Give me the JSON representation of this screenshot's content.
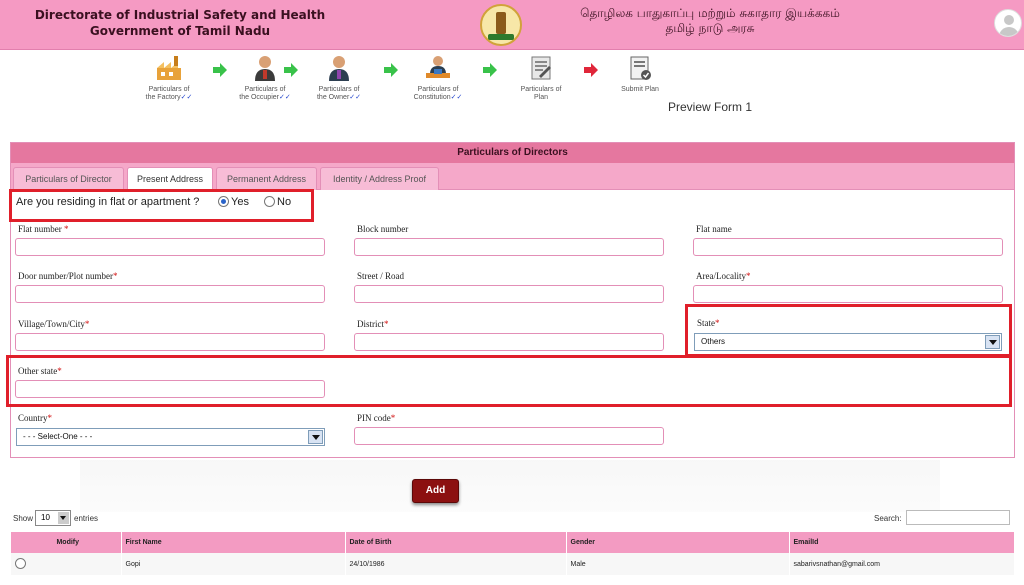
{
  "header": {
    "title_line1": "Directorate of Industrial Safety and Health",
    "title_line2": "Government of Tamil Nadu",
    "tamil_line1": "தொழிலக பாதுகாப்பு மற்றும் சுகாதார இயக்ககம்",
    "tamil_line2": "தமிழ் நாடு அரசு"
  },
  "steps": [
    {
      "line1": "Particulars of",
      "line2": "the Factory",
      "done": true
    },
    {
      "line1": "Particulars of",
      "line2": "the Occupier",
      "done": true
    },
    {
      "line1": "Particulars of",
      "line2": "the Owner",
      "done": true
    },
    {
      "line1": "Particulars of",
      "line2": "Constitution",
      "done": true
    },
    {
      "line1": "Particulars of",
      "line2": "Plan",
      "done": false
    },
    {
      "line1": "Submit Plan",
      "line2": "",
      "done": false
    }
  ],
  "check_mark": "✓✓",
  "preview_label": "Preview Form 1",
  "panel_title": "Particulars of Directors",
  "tabs": [
    "Particulars of Director",
    "Present Address",
    "Permanent Address",
    "Identity / Address Proof"
  ],
  "question": {
    "text": "Are you residing in flat or apartment ?",
    "yes": "Yes",
    "no": "No",
    "selected": "Yes"
  },
  "fields": {
    "flat_number": "Flat number",
    "block_number": "Block number",
    "flat_name": "Flat name",
    "door_number": "Door number/Plot number",
    "street": "Street / Road",
    "area": "Area/Locality",
    "village": "Village/Town/City",
    "district": "District",
    "state": "State",
    "state_value": "Others",
    "other_state": "Other state",
    "country": "Country",
    "country_value": "- - - Select-One - - -",
    "pin": "PIN code"
  },
  "required_mark": "*",
  "add_label": "Add",
  "table_controls": {
    "show": "Show",
    "entries_value": "10",
    "entries": "entries",
    "search": "Search:"
  },
  "table": {
    "headers": [
      "Modify",
      "First Name",
      "Date of Birth",
      "Gender",
      "EmailId"
    ],
    "rows": [
      [
        "",
        "Gopi",
        "24/10/1986",
        "Male",
        "sabarivsnathan@gmail.com"
      ]
    ]
  },
  "colors": {
    "header_bg": "#f59ac3",
    "highlight": "#e01f2a",
    "add_button": "#8c1010"
  }
}
